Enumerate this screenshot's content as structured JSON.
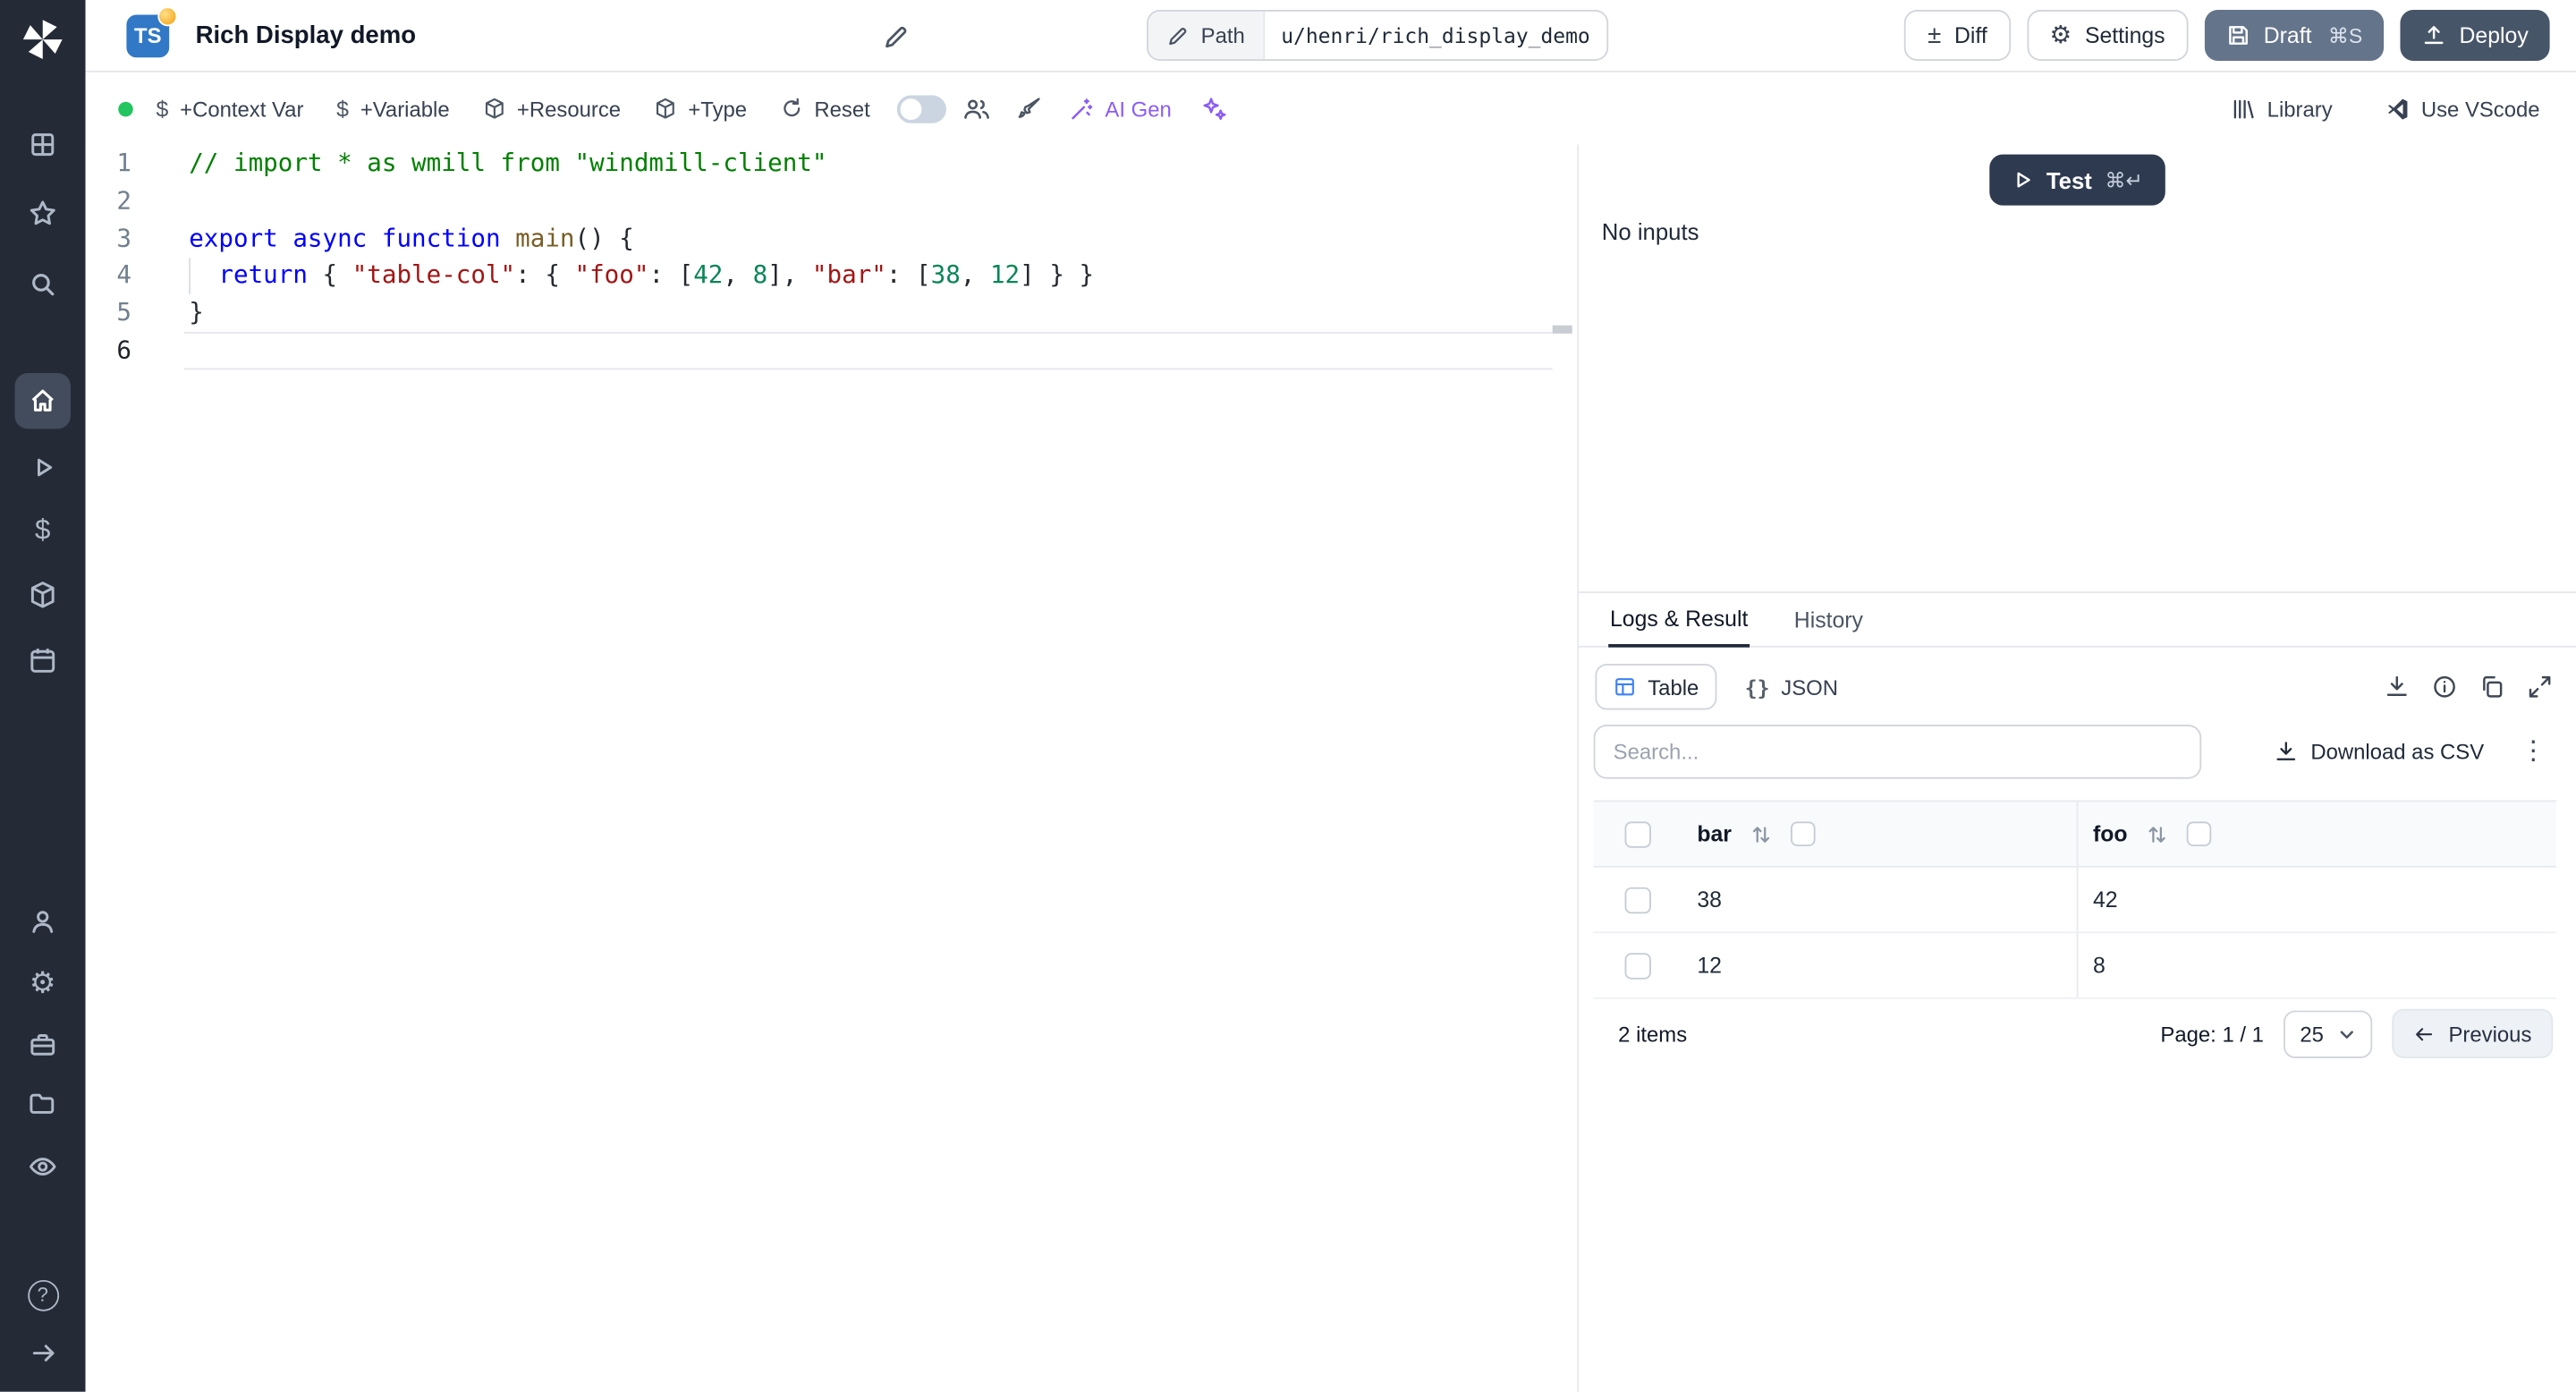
{
  "header": {
    "language_badge": "TS",
    "title": "Rich Display demo",
    "path": {
      "label": "Path",
      "value": "u/henri/rich_display_demo"
    },
    "buttons": {
      "diff": "Diff",
      "settings": "Settings",
      "draft": "Draft",
      "draft_shortcut": "⌘S",
      "deploy": "Deploy"
    }
  },
  "toolbar": {
    "context_var": "+Context Var",
    "variable": "+Variable",
    "resource": "+Resource",
    "type": "+Type",
    "reset": "Reset",
    "ai_gen": "AI Gen",
    "library": "Library",
    "vscode": "Use VScode"
  },
  "icons": {
    "diff": "±",
    "settings_gear": "⚙",
    "kebab": "⋮",
    "braces": "{}",
    "dollar": "$",
    "help": "?",
    "arrow_right": "→"
  },
  "sidebar": {
    "items": [
      {
        "icon": "windmill-logo"
      },
      {
        "icon": "grid"
      },
      {
        "icon": "star"
      },
      {
        "icon": "search"
      },
      {
        "icon": "home",
        "active": true
      },
      {
        "icon": "play"
      },
      {
        "icon": "dollar"
      },
      {
        "icon": "cube"
      },
      {
        "icon": "calendar"
      },
      {
        "icon": "user"
      },
      {
        "icon": "gear"
      },
      {
        "icon": "briefcase"
      },
      {
        "icon": "folder"
      },
      {
        "icon": "eye"
      },
      {
        "icon": "help"
      },
      {
        "icon": "arrow-right"
      }
    ]
  },
  "editor": {
    "lines": [
      [
        [
          "comment",
          "// import * as wmill from \"windmill-client\""
        ]
      ],
      [],
      [
        [
          "keyword",
          "export async function "
        ],
        [
          "fn",
          "main"
        ],
        [
          "punct",
          "() {"
        ]
      ],
      [
        [
          "plain",
          "  "
        ],
        [
          "keyword",
          "return"
        ],
        [
          "punct",
          " { "
        ],
        [
          "string",
          "\"table-col\""
        ],
        [
          "punct",
          ": { "
        ],
        [
          "string",
          "\"foo\""
        ],
        [
          "punct",
          ": ["
        ],
        [
          "number",
          "42"
        ],
        [
          "punct",
          ", "
        ],
        [
          "number",
          "8"
        ],
        [
          "punct",
          "], "
        ],
        [
          "string",
          "\"bar\""
        ],
        [
          "punct",
          ": ["
        ],
        [
          "number",
          "38"
        ],
        [
          "punct",
          ", "
        ],
        [
          "number",
          "12"
        ],
        [
          "punct",
          "] } }"
        ]
      ],
      [
        [
          "punct",
          "}"
        ]
      ],
      []
    ]
  },
  "run": {
    "test_label": "Test",
    "test_shortcut": "⌘↵",
    "no_inputs": "No inputs"
  },
  "result_panel": {
    "tabs": [
      {
        "label": "Logs & Result",
        "active": true
      },
      {
        "label": "History",
        "active": false
      }
    ],
    "view_toggle": [
      {
        "label": "Table",
        "active": true
      },
      {
        "label": "JSON",
        "active": false
      }
    ],
    "search_placeholder": "Search...",
    "download_csv": "Download as CSV",
    "table": {
      "columns": [
        "bar",
        "foo"
      ],
      "rows": [
        [
          "38",
          "42"
        ],
        [
          "12",
          "8"
        ]
      ],
      "items_label": "2 items",
      "page_label": "Page: 1 / 1",
      "page_size": "25",
      "previous_label": "Previous"
    }
  },
  "colors": {
    "sidebar_bg": "#252b36",
    "accent_violet": "#8b5cf6",
    "draft_bg": "#64748b",
    "deploy_bg": "#475569",
    "test_bg": "#2e3a4f",
    "green_dot": "#22c55e",
    "ts_badge": "#3178c6"
  }
}
